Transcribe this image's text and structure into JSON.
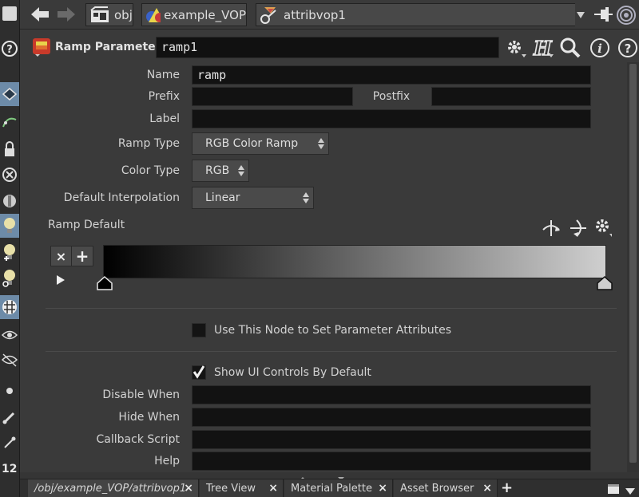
{
  "pathbar": {
    "crumbs": [
      {
        "label": "obj",
        "icon": "obj-network-icon"
      },
      {
        "label": "example_VOP",
        "icon": "vop-network-icon"
      },
      {
        "label": "attribvop1",
        "icon": "attribvop-node-icon"
      }
    ]
  },
  "header": {
    "parm_type": "Ramp Parameter",
    "node_name": "ramp1"
  },
  "form": {
    "name_label": "Name",
    "name_value": "ramp",
    "prefix_label": "Prefix",
    "prefix_value": "",
    "postfix_label": "Postfix",
    "postfix_value": "",
    "label_label": "Label",
    "label_value": "",
    "ramp_type_label": "Ramp Type",
    "ramp_type_value": "RGB Color Ramp",
    "color_type_label": "Color Type",
    "color_type_value": "RGB",
    "default_interp_label": "Default Interpolation",
    "default_interp_value": "Linear",
    "ramp_default_label": "Ramp Default",
    "use_node_label": "Use This Node to Set Parameter Attributes",
    "use_node_checked": false,
    "show_ui_label": "Show UI Controls By Default",
    "show_ui_checked": true,
    "disable_when_label": "Disable When",
    "disable_when_value": "",
    "hide_when_label": "Hide When",
    "hide_when_value": "",
    "callback_label": "Callback Script",
    "callback_value": "",
    "help_label": "Help",
    "help_value": ""
  },
  "ramp": {
    "start_color": "#000000",
    "end_color": "#cfcfcf",
    "remove_key_label": "×",
    "add_key_label": "+"
  },
  "shelf": {
    "number_label": "12"
  },
  "tabs": [
    {
      "label": "/obj/example_VOP/attribvop1",
      "active": true
    },
    {
      "label": "Tree View",
      "active": false
    },
    {
      "label": "Material Palette",
      "active": false
    },
    {
      "label": "Asset Browser",
      "active": false
    }
  ],
  "tab_close_label": "×",
  "add_tab_label": "+",
  "colors": {
    "accent": "#6d8ba8",
    "panel_bg": "#3a3a3a",
    "field_bg": "#121212"
  }
}
